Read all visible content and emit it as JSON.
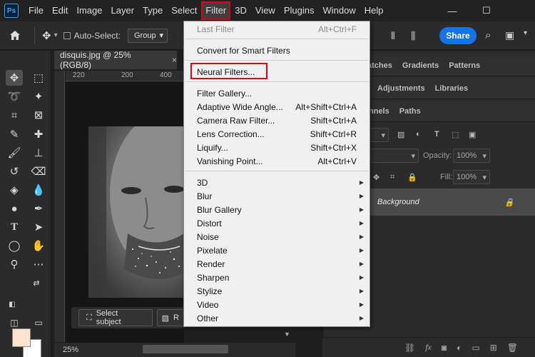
{
  "app_logo": "Ps",
  "menubar": {
    "items": [
      "File",
      "Edit",
      "Image",
      "Layer",
      "Type",
      "Select",
      "Filter",
      "3D",
      "View",
      "Plugins",
      "Window",
      "Help"
    ],
    "active": "Filter"
  },
  "window_controls": {
    "minimize": "—",
    "maximize": "☐"
  },
  "options_bar": {
    "auto_select_label": "Auto-Select:",
    "group_value": "Group",
    "share_label": "Share"
  },
  "document": {
    "tab_title": "disquis.jpg @ 25% (RGB/8)",
    "close_glyph": "×",
    "ruler_marks": [
      "220",
      "200",
      "400"
    ],
    "zoom": "25%",
    "select_subject_label": "Select subject",
    "remove_bg_label": "R"
  },
  "panels": {
    "tabs_row1": [
      "atches",
      "Gradients",
      "Patterns"
    ],
    "tabs_row2": [
      "Adjustments",
      "Libraries"
    ],
    "tabs_row3": [
      "nnels",
      "Paths"
    ],
    "opacity_label": "Opacity:",
    "opacity_value": "100%",
    "fill_label": "Fill:",
    "fill_value": "100%",
    "layer_name": "Background"
  },
  "filter_menu": {
    "last_filter": {
      "label": "Last Filter",
      "shortcut": "Alt+Ctrl+F"
    },
    "convert_smart": "Convert for Smart Filters",
    "neural_filters": "Neural Filters...",
    "group1": [
      {
        "label": "Filter Gallery...",
        "shortcut": ""
      },
      {
        "label": "Adaptive Wide Angle...",
        "shortcut": "Alt+Shift+Ctrl+A"
      },
      {
        "label": "Camera Raw Filter...",
        "shortcut": "Shift+Ctrl+A"
      },
      {
        "label": "Lens Correction...",
        "shortcut": "Shift+Ctrl+R"
      },
      {
        "label": "Liquify...",
        "shortcut": "Shift+Ctrl+X"
      },
      {
        "label": "Vanishing Point...",
        "shortcut": "Alt+Ctrl+V"
      }
    ],
    "submenus": [
      "3D",
      "Blur",
      "Blur Gallery",
      "Distort",
      "Noise",
      "Pixelate",
      "Render",
      "Sharpen",
      "Stylize",
      "Video",
      "Other"
    ]
  },
  "colors": {
    "foreground": "#fce3cc",
    "background": "#ffffff",
    "accent": "#1473e6",
    "highlight": "#e0001a"
  }
}
